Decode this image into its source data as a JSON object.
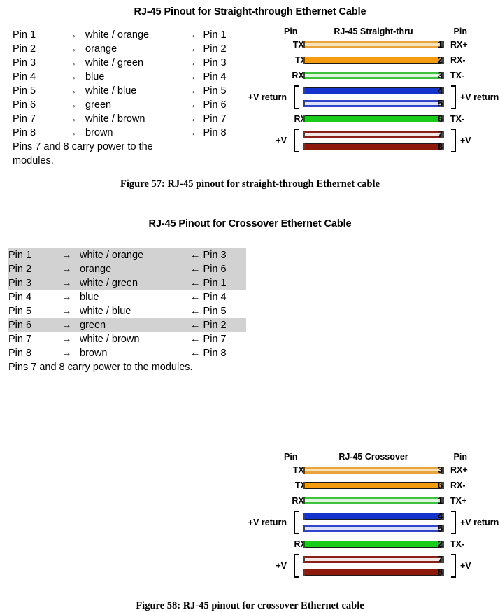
{
  "straight": {
    "title": "RJ-45 Pinout for Straight-through Ethernet Cable",
    "caption": "Figure 57: RJ-45 pinout for straight-through Ethernet cable",
    "note": "Pins 7 and 8 carry power to the\nmodules.",
    "arrow_left": "→",
    "arrow_right": "←",
    "rows": [
      {
        "left": "Pin 1",
        "color": "white / orange",
        "right": "Pin 1",
        "highlight": false
      },
      {
        "left": "Pin 2",
        "color": "orange",
        "right": "Pin 2",
        "highlight": false
      },
      {
        "left": "Pin 3",
        "color": "white / green",
        "right": "Pin 3",
        "highlight": false
      },
      {
        "left": "Pin 4",
        "color": "blue",
        "right": "Pin 4",
        "highlight": false
      },
      {
        "left": "Pin 5",
        "color": "white / blue",
        "right": "Pin 5",
        "highlight": false
      },
      {
        "left": "Pin 6",
        "color": "green",
        "right": "Pin 6",
        "highlight": false
      },
      {
        "left": "Pin 7",
        "color": "white / brown",
        "right": "Pin 7",
        "highlight": false
      },
      {
        "left": "Pin 8",
        "color": "brown",
        "right": "Pin 8",
        "highlight": false
      }
    ],
    "diagram": {
      "header_left": "Pin",
      "header_center": "RJ-45 Straight-thru",
      "header_right": "Pin",
      "bracket_left_label": "+V return",
      "bracket_left_label2": "+V",
      "bracket_right_label": "+V return",
      "bracket_right_label2": "+V",
      "wires": [
        {
          "sig_l": "TX+",
          "pin_l": "1",
          "pin_r": "1",
          "sig_r": "RX+",
          "style": "striped",
          "color": "#E8A33D",
          "fill": "#FAE3B8"
        },
        {
          "sig_l": "TX-",
          "pin_l": "2",
          "pin_r": "2",
          "sig_r": "RX-",
          "style": "solid",
          "color": "#F59B10",
          "fill": "#F59B10"
        },
        {
          "sig_l": "RX+",
          "pin_l": "3",
          "pin_r": "3",
          "sig_r": "TX-",
          "style": "striped",
          "color": "#3FC33F",
          "fill": "#DFF7DF"
        },
        {
          "sig_l": "",
          "pin_l": "4",
          "pin_r": "4",
          "sig_r": "",
          "style": "solid",
          "color": "#1433CC",
          "fill": "#1433CC"
        },
        {
          "sig_l": "",
          "pin_l": "5",
          "pin_r": "5",
          "sig_r": "",
          "style": "striped",
          "color": "#3344CC",
          "fill": "#DDE2F6"
        },
        {
          "sig_l": "RX-",
          "pin_l": "6",
          "pin_r": "6",
          "sig_r": "TX-",
          "style": "solid",
          "color": "#19CC19",
          "fill": "#19CC19"
        },
        {
          "sig_l": "",
          "pin_l": "7",
          "pin_r": "7",
          "sig_r": "",
          "style": "striped",
          "color": "#8A2018",
          "fill": "#F2E8E6"
        },
        {
          "sig_l": "",
          "pin_l": "8",
          "pin_r": "8",
          "sig_r": "",
          "style": "solid",
          "color": "#8E1A0C",
          "fill": "#8E1A0C"
        }
      ]
    }
  },
  "crossover": {
    "title": "RJ-45 Pinout for Crossover Ethernet Cable",
    "caption": "Figure 58: RJ-45 pinout for crossover Ethernet cable",
    "note": "Pins 7 and 8 carry power to the modules.",
    "arrow_left": "→",
    "arrow_right": "←",
    "rows": [
      {
        "left": "Pin 1",
        "color": "white / orange",
        "right": "Pin 3",
        "highlight": true
      },
      {
        "left": "Pin 2",
        "color": "orange",
        "right": "Pin 6",
        "highlight": true
      },
      {
        "left": "Pin 3",
        "color": "white / green",
        "right": "Pin 1",
        "highlight": true
      },
      {
        "left": "Pin 4",
        "color": "blue",
        "right": "Pin 4",
        "highlight": false
      },
      {
        "left": "Pin 5",
        "color": "white / blue",
        "right": "Pin 5",
        "highlight": false
      },
      {
        "left": "Pin 6",
        "color": "green",
        "right": "Pin 2",
        "highlight": true
      },
      {
        "left": "Pin 7",
        "color": "white / brown",
        "right": "Pin 7",
        "highlight": false
      },
      {
        "left": "Pin 8",
        "color": "brown",
        "right": "Pin 8",
        "highlight": false
      }
    ],
    "diagram": {
      "header_left": "Pin",
      "header_center": "RJ-45 Crossover",
      "header_right": "Pin",
      "bracket_left_label": "+V return",
      "bracket_left_label2": "+V",
      "bracket_right_label": "+V return",
      "bracket_right_label2": "+V",
      "wires": [
        {
          "sig_l": "TX+",
          "pin_l": "1",
          "pin_r": "3",
          "sig_r": "RX+",
          "style": "striped",
          "color": "#E8A33D",
          "fill": "#FAE3B8"
        },
        {
          "sig_l": "TX-",
          "pin_l": "2",
          "pin_r": "6",
          "sig_r": "RX-",
          "style": "solid",
          "color": "#F59B10",
          "fill": "#F59B10"
        },
        {
          "sig_l": "RX+",
          "pin_l": "3",
          "pin_r": "1",
          "sig_r": "TX+",
          "style": "striped",
          "color": "#3FC33F",
          "fill": "#DFF7DF"
        },
        {
          "sig_l": "",
          "pin_l": "4",
          "pin_r": "4",
          "sig_r": "",
          "style": "solid",
          "color": "#1433CC",
          "fill": "#1433CC"
        },
        {
          "sig_l": "",
          "pin_l": "5",
          "pin_r": "5",
          "sig_r": "",
          "style": "striped",
          "color": "#3344CC",
          "fill": "#DDE2F6"
        },
        {
          "sig_l": "RX-",
          "pin_l": "6",
          "pin_r": "2",
          "sig_r": "TX-",
          "style": "solid",
          "color": "#19CC19",
          "fill": "#19CC19"
        },
        {
          "sig_l": "",
          "pin_l": "7",
          "pin_r": "7",
          "sig_r": "",
          "style": "striped",
          "color": "#8A2018",
          "fill": "#F2E8E6"
        },
        {
          "sig_l": "",
          "pin_l": "8",
          "pin_r": "8",
          "sig_r": "",
          "style": "solid",
          "color": "#8E1A0C",
          "fill": "#8E1A0C"
        }
      ]
    }
  },
  "colors": {
    "highlight_row": "#d2d2d2",
    "page_background": "#ffffff",
    "text": "#000000"
  }
}
